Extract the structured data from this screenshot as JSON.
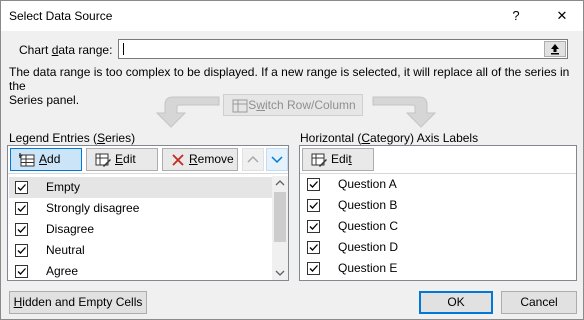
{
  "window": {
    "title": "Select Data Source",
    "help_glyph": "?",
    "close_glyph": "✕"
  },
  "range": {
    "label_pre": "Chart ",
    "label_u": "d",
    "label_post": "ata range:",
    "value": "",
    "collapse_icon": "upload-icon"
  },
  "message": {
    "line1": "The data range is too complex to be displayed. If a new range is selected, it will replace all of the series in the",
    "line2": "Series panel."
  },
  "switch": {
    "pre": "S",
    "u": "w",
    "post": "itch Row/Column"
  },
  "legend": {
    "heading_pre": "Legend Entries (",
    "heading_u": "S",
    "heading_post": "eries)",
    "add_pre": "",
    "add_u": "A",
    "add_post": "dd",
    "edit_pre": "",
    "edit_u": "E",
    "edit_post": "dit",
    "remove_pre": "",
    "remove_u": "R",
    "remove_post": "emove",
    "items": [
      {
        "label": "Empty",
        "checked": true
      },
      {
        "label": "Strongly disagree",
        "checked": true
      },
      {
        "label": "Disagree",
        "checked": true
      },
      {
        "label": "Neutral",
        "checked": true
      },
      {
        "label": "Agree",
        "checked": true
      }
    ]
  },
  "axis": {
    "heading_pre": "Horizontal (",
    "heading_u": "C",
    "heading_post": "ategory) Axis Labels",
    "edit_pre": "Edi",
    "edit_u": "t",
    "edit_post": "",
    "items": [
      {
        "label": "Question A",
        "checked": true
      },
      {
        "label": "Question B",
        "checked": true
      },
      {
        "label": "Question C",
        "checked": true
      },
      {
        "label": "Question D",
        "checked": true
      },
      {
        "label": "Question E",
        "checked": true
      }
    ]
  },
  "footer": {
    "hidden_pre": "",
    "hidden_u": "H",
    "hidden_post": "idden and Empty Cells",
    "ok": "OK",
    "cancel": "Cancel"
  },
  "colors": {
    "accent": "#0078d7",
    "remove_x": "#c42b1c",
    "selected_row": "#e5e5e5"
  }
}
